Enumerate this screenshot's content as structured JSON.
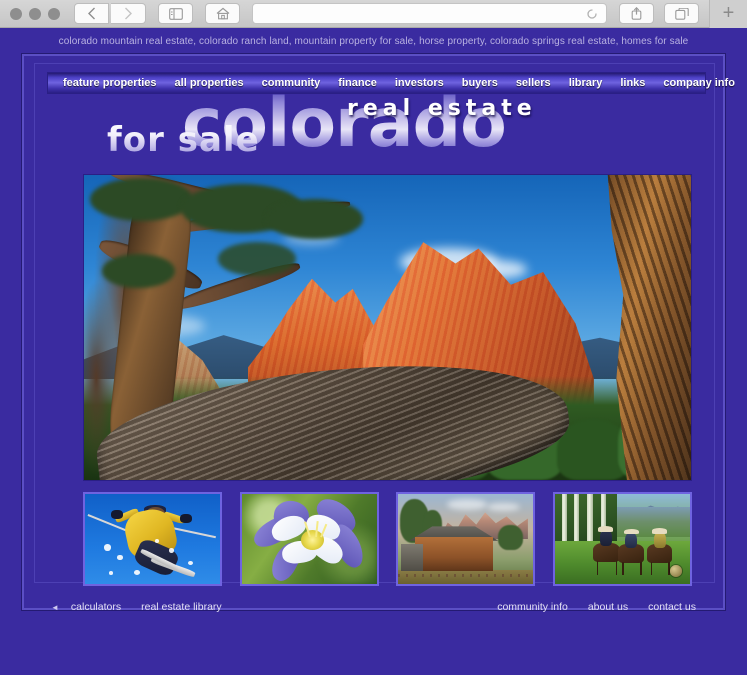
{
  "browser": {
    "window_dots": [
      "close",
      "minimize",
      "zoom"
    ],
    "buttons": [
      {
        "name": "back-button",
        "glyph": "‹"
      },
      {
        "name": "forward-button",
        "glyph": "›"
      },
      {
        "name": "sidebar-button",
        "glyph": "▥"
      },
      {
        "name": "home-button",
        "glyph": "⌂"
      }
    ],
    "url_value": "",
    "url_placeholder": "",
    "reload_icon": "reload-icon",
    "share_icon": "share-icon",
    "tabs_icon": "tabs-icon",
    "new_tab_label": "+"
  },
  "page": {
    "keywords": "colorado mountain real estate, colorado ranch land, mountain property for sale, horse property, colorado springs real estate, homes for sale",
    "nav": [
      {
        "label": "feature properties"
      },
      {
        "label": "all properties"
      },
      {
        "label": "community"
      },
      {
        "label": "finance"
      },
      {
        "label": "investors"
      },
      {
        "label": "buyers"
      },
      {
        "label": "sellers"
      },
      {
        "label": "library"
      },
      {
        "label": "links"
      },
      {
        "label": "company info"
      }
    ],
    "title": {
      "main": "colorado",
      "upper": "real estate",
      "lower": "for sale"
    },
    "hero": {
      "alt": "Garden of the Gods red rock formations with gnarled juniper tree at sunrise"
    },
    "thumbnails": [
      {
        "name": "thumb-skiing",
        "alt": "skier in yellow suit carving powder against blue sky"
      },
      {
        "name": "thumb-columbine",
        "alt": "blue and white Colorado columbine flower close-up"
      },
      {
        "name": "thumb-barn",
        "alt": "historic log barn below Teton mountain range at sunrise"
      },
      {
        "name": "thumb-horseback",
        "alt": "three horseback riders in green mountain meadow"
      }
    ],
    "footer": {
      "back_glyph": "◄",
      "left_links": [
        {
          "label": "calculators"
        },
        {
          "label": "real estate library"
        }
      ],
      "right_links": [
        {
          "label": "community info"
        },
        {
          "label": "about us"
        },
        {
          "label": "contact us"
        }
      ]
    }
  },
  "colors": {
    "page_bg": "#3a2ba0",
    "frame_border": "#5b4fc4",
    "nav_highlight": "#6f63e0",
    "text_light": "#e3e0f4",
    "keyword_text": "#b9b2e2"
  }
}
